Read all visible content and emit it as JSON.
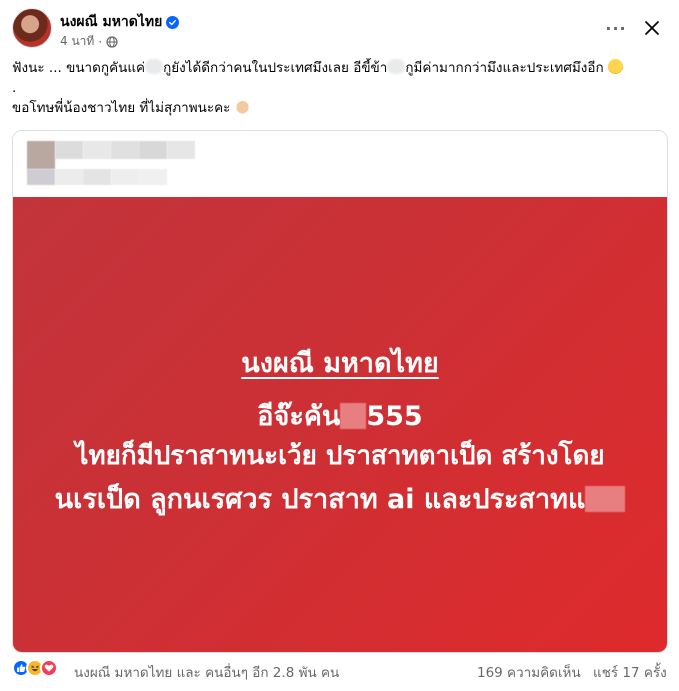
{
  "post": {
    "author": "นงผณี มหาดไทย",
    "time": "4 นาที",
    "privacy_icon": "globe-icon",
    "verified_icon": "verified-badge-icon",
    "caption": {
      "line1_a": "ฟังนะ ... ขนาดกูคันแค่",
      "line1_b": "กูยังได้ดีกว่าคนในประเทศมึงเลย อีขี้ข้า",
      "line1_c": "กูมีค่ามากกว่ามึงและประเทศมึงอีก",
      "line2": ".",
      "line3": "ขอโทษพี่น้องชาวไทย ที่ไม่สุภาพนะคะ"
    },
    "image": {
      "title": "นงผณี มหาดไทย",
      "line1_a": "อีจ๊ะคัน",
      "line1_b": "555",
      "line2": "ไทยก็มีปราสาทนะเว้ย ปราสาทตาเป็ด สร้างโดย",
      "line3_a": "นเรเป็ด ลูกนเรศวร ปราสาท ai และประสาทแ",
      "background_color": "#cf2f35"
    },
    "footer": {
      "reactors": "นงผณี มหาดไทย และ คนอื่นๆ อีก 2.8 พัน คน",
      "comments": "169 ความคิดเห็น",
      "shares": "แชร์ 17 ครั้ง",
      "reaction_icons": [
        "like-icon",
        "haha-icon",
        "love-icon"
      ]
    },
    "accent_color": "#0866ff"
  }
}
